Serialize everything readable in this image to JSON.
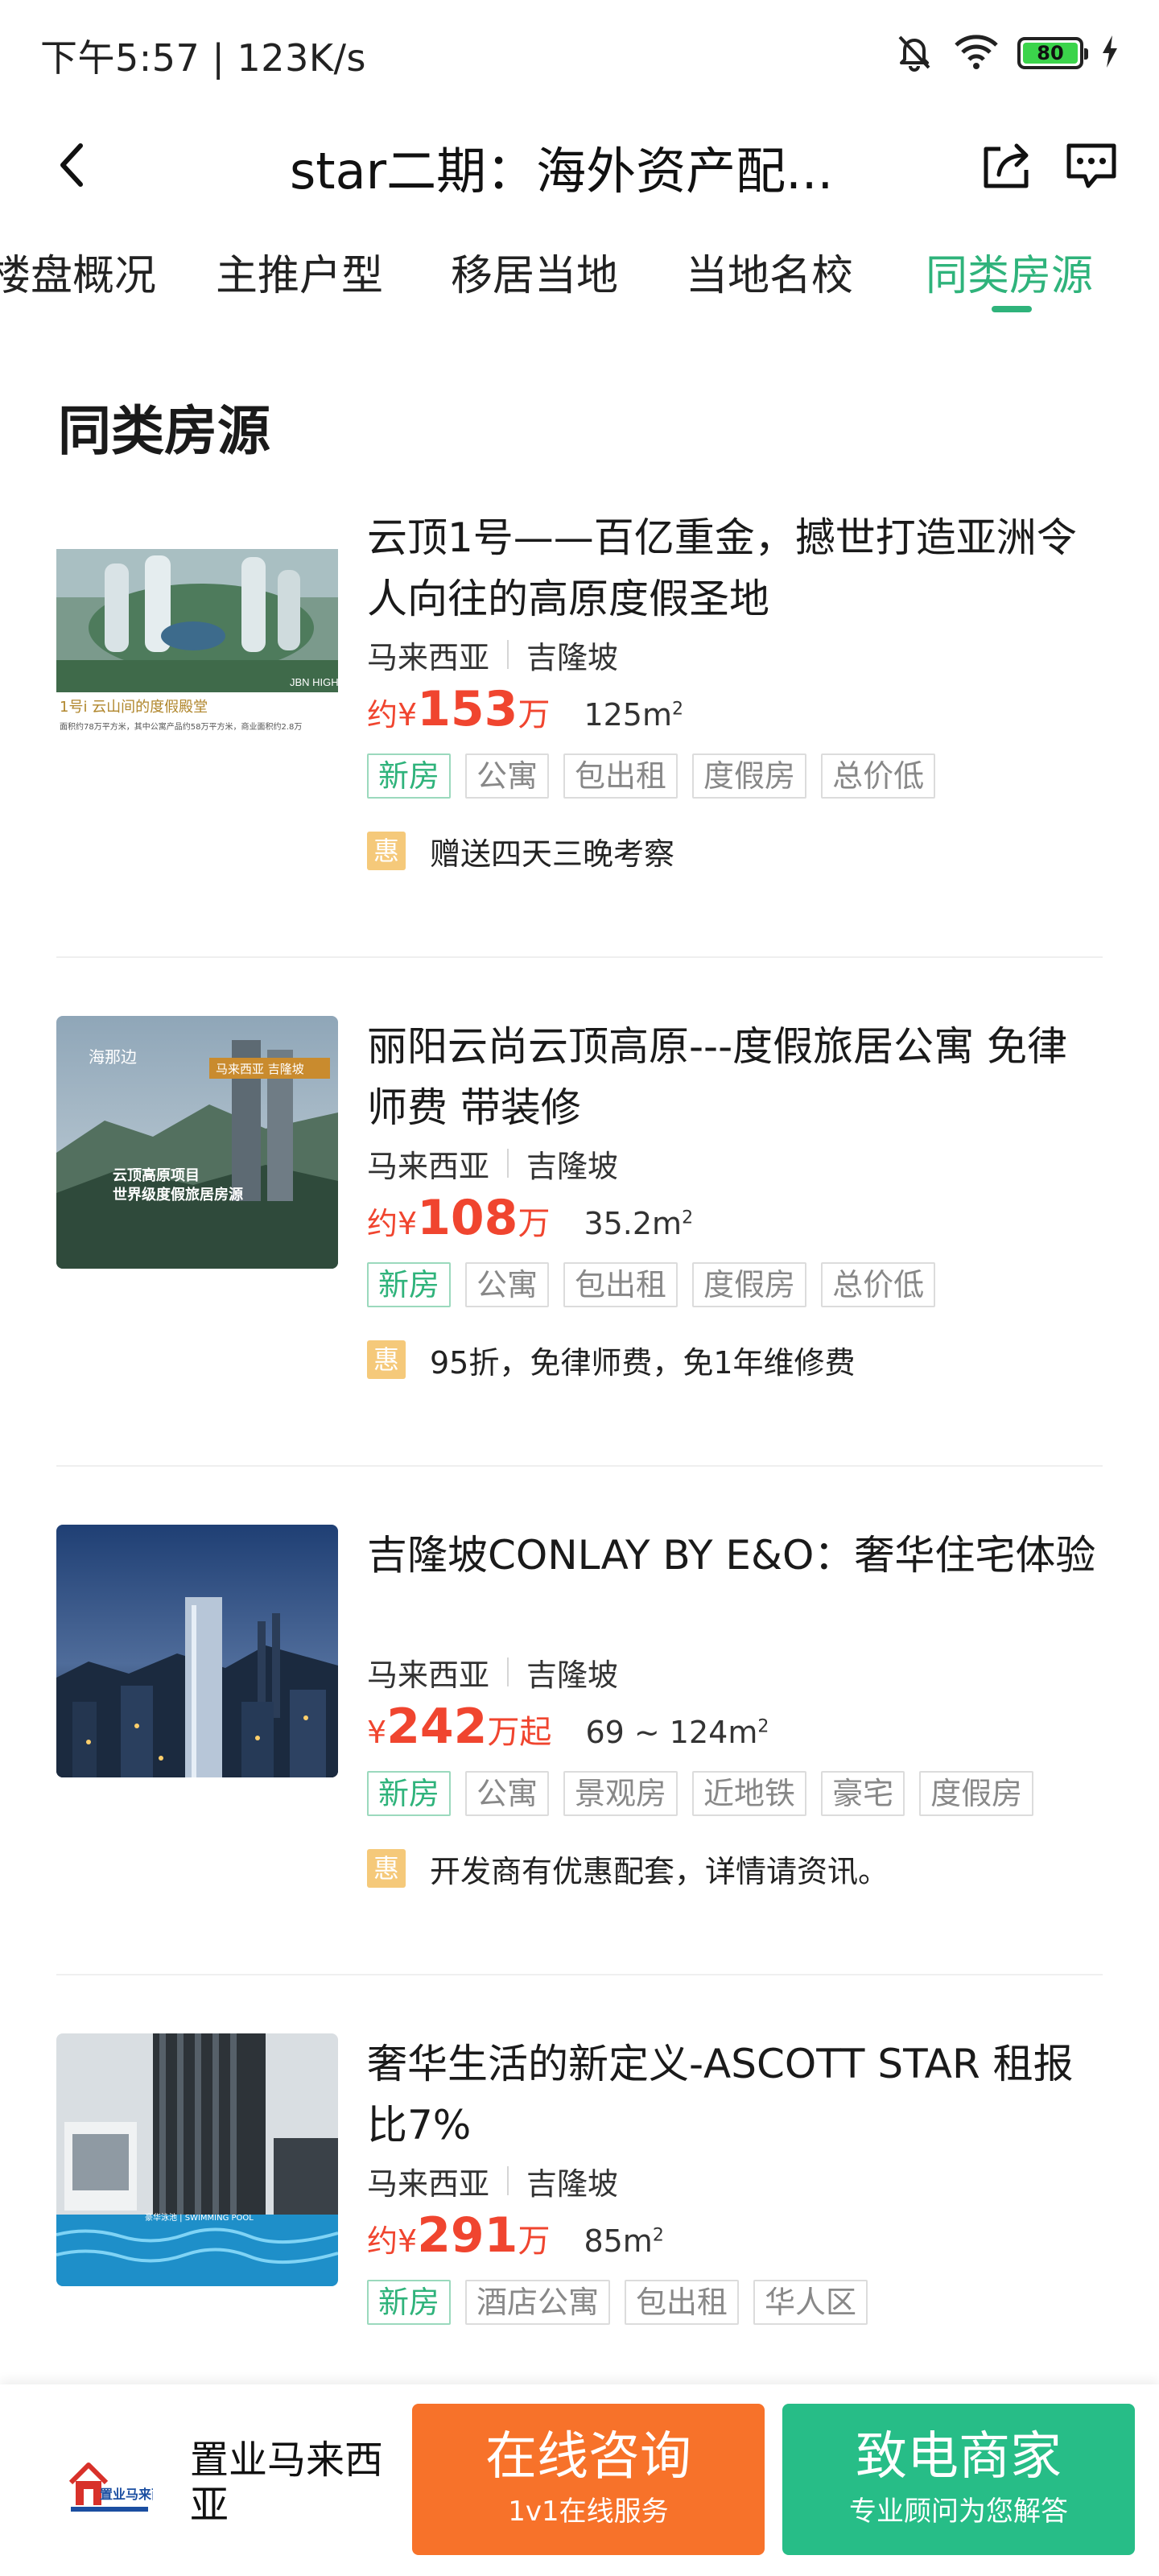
{
  "status": {
    "time_speed": "下午5:57 | 123K/s",
    "battery": "80"
  },
  "nav": {
    "title": "star二期：海外资产配..."
  },
  "tabs": [
    {
      "label": "楼盘概况",
      "active": false
    },
    {
      "label": "主推户型",
      "active": false
    },
    {
      "label": "移居当地",
      "active": false
    },
    {
      "label": "当地名校",
      "active": false
    },
    {
      "label": "同类房源",
      "active": true
    }
  ],
  "section_title": "同类房源",
  "listings": [
    {
      "title": "云顶1号——百亿重金，撼世打造亚洲令人向往的高原度假圣地",
      "country": "马来西亚",
      "city": "吉隆坡",
      "price_prefix": "约¥",
      "price": "153",
      "price_unit": "万",
      "area": "125m",
      "area_sup": "2",
      "tags": [
        "新房",
        "公寓",
        "包出租",
        "度假房",
        "总价低"
      ],
      "promo_badge": "惠",
      "promo": "赠送四天三晚考察",
      "thumb_caption": "1号i 云山间的度假殿堂",
      "thumb_caption2": "面积约78万平方米，其中公寓产品约58万平方米，商业面积约2.8万",
      "thumb_mark": "JBN HIGHL"
    },
    {
      "title": "丽阳云尚云顶高原---度假旅居公寓 免律师费 带装修",
      "country": "马来西亚",
      "city": "吉隆坡",
      "price_prefix": "约¥",
      "price": "108",
      "price_unit": "万",
      "area": "35.2m",
      "area_sup": "2",
      "tags": [
        "新房",
        "公寓",
        "包出租",
        "度假房",
        "总价低"
      ],
      "promo_badge": "惠",
      "promo": "95折，免律师费，免1年维修费",
      "thumb_brand": "海那边",
      "thumb_badge": "马来西亚 吉隆坡",
      "thumb_line1": "云顶高原项目",
      "thumb_line2": "世界级度假旅居房源"
    },
    {
      "title": "吉隆坡CONLAY BY E&O：奢华住宅体验",
      "country": "马来西亚",
      "city": "吉隆坡",
      "price_prefix": "¥",
      "price": "242",
      "price_unit": "万起",
      "area": "69 ~ 124m",
      "area_sup": "2",
      "tags": [
        "新房",
        "公寓",
        "景观房",
        "近地铁",
        "豪宅",
        "度假房"
      ],
      "promo_badge": "惠",
      "promo": "开发商有优惠配套，详情请资讯。"
    },
    {
      "title": "奢华生活的新定义-ASCOTT STAR 租报比7%",
      "country": "马来西亚",
      "city": "吉隆坡",
      "price_prefix": "约¥",
      "price": "291",
      "price_unit": "万",
      "area": "85m",
      "area_sup": "2",
      "tags": [
        "新房",
        "酒店公寓",
        "包出租",
        "华人区"
      ],
      "thumb_caption": "豪华泳池 | SWIMMING POOL"
    }
  ],
  "bottom": {
    "store_name": "置业马来西亚",
    "logo_text": "置业马来西亚",
    "consult_main": "在线咨询",
    "consult_sub": "1v1在线服务",
    "call_main": "致电商家",
    "call_sub": "专业顾问为您解答"
  },
  "colors": {
    "accent_green": "#2fb37b",
    "price_red": "#f0452f",
    "consult_orange": "#f7722a",
    "call_green": "#27bd87"
  }
}
